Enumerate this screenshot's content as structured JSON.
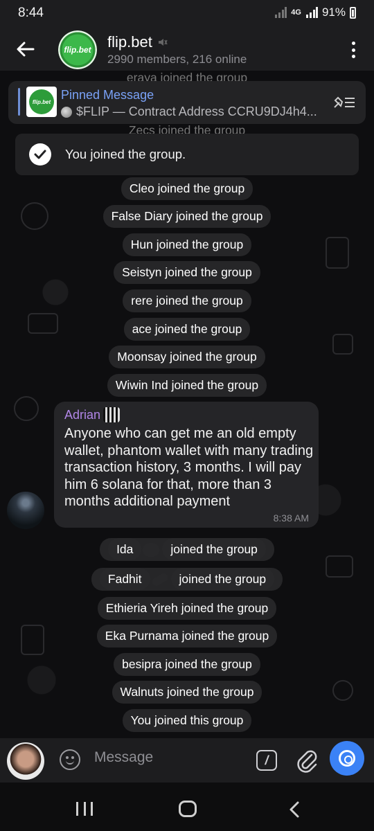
{
  "status_bar": {
    "time": "8:44",
    "network": "4G",
    "battery": "91%"
  },
  "header": {
    "title": "flip.bet",
    "subtitle": "2990 members, 216 online",
    "logo_text": "flip.bet"
  },
  "pinned": {
    "title": "Pinned Message",
    "text": "$FLIP — Contract Address  CCRU9DJ4h4..."
  },
  "toast": {
    "text": "You joined the group."
  },
  "faded_events": [
    "eraya joined the group",
    "Zecs joined the group"
  ],
  "events_top": [
    "Cleo joined the group",
    "False Diary joined the group",
    "Hun joined the group",
    "Seistyn joined the group",
    "rere joined the group",
    "ace joined the group",
    "Moonsay joined the group",
    "Wiwin Ind joined the group"
  ],
  "message": {
    "sender": "Adrian",
    "text": "Anyone who can get me an old empty wallet, phantom wallet with many trading transaction history, 3 months. I will pay him 6 solana for that, more than 3 months additional payment",
    "time": "8:38 AM"
  },
  "events_bottom": {
    "ida_name": "Ida",
    "ida_rest": "joined the group",
    "fadhit_name": "Fadhit",
    "fadhit_rest": "joined the group",
    "items": [
      "Ethieria Yireh joined the group",
      "Eka Purnama joined the group",
      "besipra joined the group",
      "Walnuts joined the group",
      "You joined this group"
    ]
  },
  "input": {
    "placeholder": "Message",
    "command_symbol": "/"
  },
  "colors": {
    "accent": "#3b82f6",
    "sender_name": "#b086e6",
    "pinned_title": "#7aa2f7",
    "logo_green": "#2d9c3a"
  }
}
